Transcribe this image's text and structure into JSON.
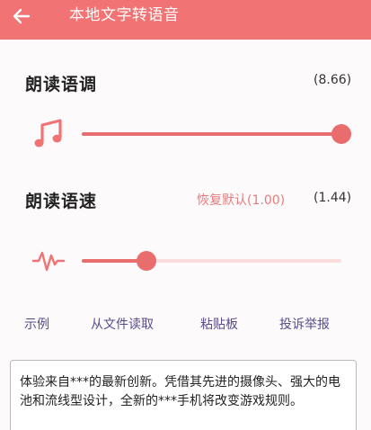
{
  "header": {
    "title": "本地文字转语音"
  },
  "pitch": {
    "label": "朗读语调",
    "value_text": "(8.66)",
    "level": 1.0
  },
  "speed": {
    "label": "朗读语速",
    "reset_label": "恢复默认(1.00)",
    "value_text": "(1.44)",
    "level": 0.25
  },
  "actions": {
    "example": "示例",
    "from_file": "从文件读取",
    "clipboard": "粘贴板",
    "report": "投诉举报"
  },
  "input": {
    "text": "体验来自***的最新创新。凭借其先进的摄像头、强大的电池和流线型设计，全新的***手机将改变游戏规则。"
  },
  "colors": {
    "accent": "#f27373",
    "slider_fill": "#ea6d6d",
    "slider_track": "#f9dcdc",
    "link": "#5a4a8a",
    "reset_link": "#e77b7b"
  },
  "icons": {
    "back": "arrow-left",
    "pitch": "music-note",
    "speed": "waveform"
  }
}
